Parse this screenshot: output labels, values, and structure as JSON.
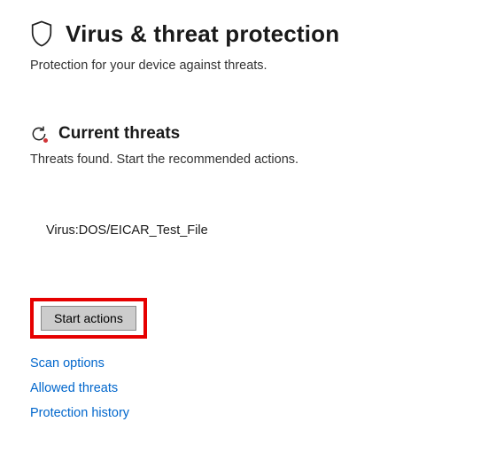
{
  "header": {
    "title": "Virus & threat protection",
    "subtitle": "Protection for your device against threats."
  },
  "threats_section": {
    "heading": "Current threats",
    "subheading": "Threats found. Start the recommended actions.",
    "items": [
      {
        "name": "Virus:DOS/EICAR_Test_File"
      }
    ]
  },
  "actions": {
    "start_button_label": "Start actions"
  },
  "links": {
    "scan_options": "Scan options",
    "allowed_threats": "Allowed threats",
    "protection_history": "Protection history"
  }
}
